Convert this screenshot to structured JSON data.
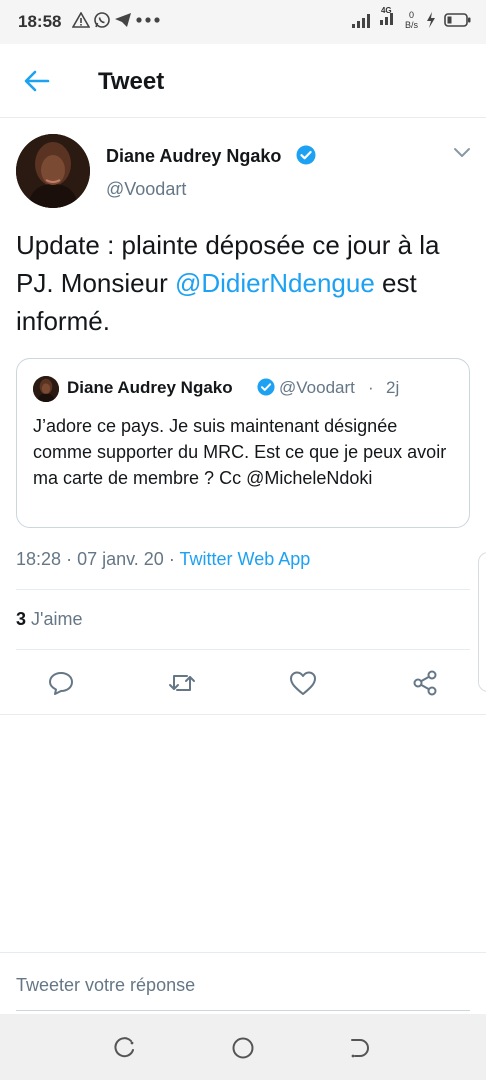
{
  "status_bar": {
    "time": "18:58",
    "signal_badge": "4G",
    "net_speed_value": "0",
    "net_speed_unit": "B/s",
    "icons": [
      "warning-icon",
      "whatsapp-icon",
      "telegram-icon",
      "more-dots-icon",
      "signal-icon",
      "signal-icon",
      "charging-icon",
      "battery-icon"
    ]
  },
  "header": {
    "title": "Tweet",
    "back_icon": "arrow-left-icon"
  },
  "tweet": {
    "author_name": "Diane Audrey Ngako",
    "author_handle": "@Voodart",
    "verified": true,
    "text_before": "Update : plainte déposée ce jour à la PJ. Monsieur ",
    "mention": "@DidierNdengue",
    "text_after": " est informé.",
    "time": "18:28",
    "sep1": "·",
    "date": "07 janv. 20",
    "sep2": "·",
    "source": "Twitter Web App",
    "likes_count": "3",
    "likes_label": " J'aime",
    "actions": [
      "reply-icon",
      "retweet-icon",
      "like-icon",
      "share-icon"
    ]
  },
  "quoted_tweet": {
    "author_name": "Diane Audrey Ngako",
    "author_handle": "@Voodart",
    "separator": "·",
    "time_ago": "2j",
    "verified": true,
    "text": "J’adore ce pays. Je suis maintenant désignée comme supporter du MRC. Est ce que je peux avoir ma carte de membre ? Cc @MicheleNdoki"
  },
  "reply": {
    "placeholder": "Tweeter votre réponse"
  },
  "colors": {
    "accent": "#1da1f2",
    "secondary_text": "#657786",
    "primary_text": "#14171a",
    "border": "#e6ecf0"
  }
}
